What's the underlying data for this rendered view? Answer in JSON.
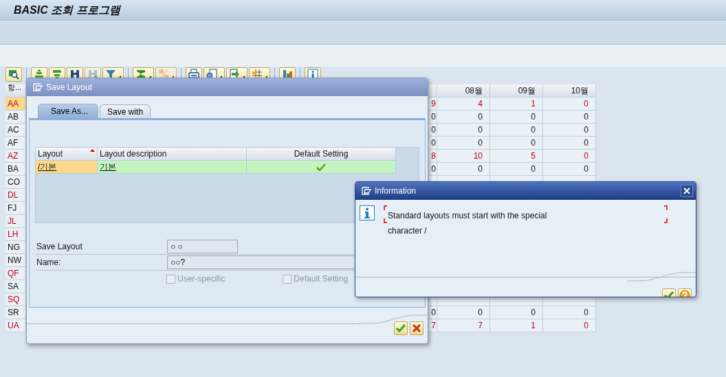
{
  "window": {
    "title": "BASIC 조회 프로그램"
  },
  "toolbar": [
    [
      {
        "kind": "details",
        "disabled": false,
        "menu": false
      }
    ],
    [
      {
        "kind": "sort-up",
        "disabled": false,
        "menu": false
      },
      {
        "kind": "sort-down",
        "disabled": false,
        "menu": false
      },
      {
        "kind": "find",
        "disabled": false,
        "menu": false
      },
      {
        "kind": "find-next",
        "disabled": true,
        "menu": false
      },
      {
        "kind": "filter",
        "disabled": false,
        "menu": true
      }
    ],
    [
      {
        "kind": "sum",
        "disabled": false,
        "menu": true
      },
      {
        "kind": "subtotal",
        "disabled": true,
        "menu": true
      }
    ],
    [
      {
        "kind": "print",
        "disabled": false,
        "menu": false
      },
      {
        "kind": "view",
        "disabled": false,
        "menu": true
      },
      {
        "kind": "export",
        "disabled": false,
        "menu": true
      },
      {
        "kind": "layout",
        "disabled": false,
        "menu": true
      }
    ],
    [
      {
        "kind": "chart",
        "disabled": false,
        "menu": false
      }
    ],
    [
      {
        "kind": "info",
        "disabled": false,
        "menu": false
      }
    ]
  ],
  "grid": {
    "code_header": "항...",
    "month_headers": [
      "08월",
      "09월",
      "10월"
    ],
    "rows": [
      {
        "code": "AA",
        "alert": true,
        "selected": true,
        "values": [
          "9",
          "4",
          "1",
          "0"
        ]
      },
      {
        "code": "AB",
        "alert": false,
        "selected": false,
        "values": [
          "0",
          "0",
          "0",
          "0"
        ]
      },
      {
        "code": "AC",
        "alert": false,
        "selected": false,
        "values": [
          "0",
          "0",
          "0",
          "0"
        ]
      },
      {
        "code": "AF",
        "alert": false,
        "selected": false,
        "values": [
          "0",
          "0",
          "0",
          "0"
        ]
      },
      {
        "code": "AZ",
        "alert": true,
        "selected": false,
        "values": [
          "8",
          "10",
          "5",
          "0"
        ]
      },
      {
        "code": "BA",
        "alert": false,
        "selected": false,
        "values": [
          "0",
          "0",
          "0",
          "0"
        ]
      },
      {
        "code": "CO",
        "alert": false,
        "selected": false
      },
      {
        "code": "DL",
        "alert": true,
        "selected": false
      },
      {
        "code": "FJ",
        "alert": false,
        "selected": false
      },
      {
        "code": "JL",
        "alert": true,
        "selected": false
      },
      {
        "code": "LH",
        "alert": true,
        "selected": false
      },
      {
        "code": "NG",
        "alert": false,
        "selected": false
      },
      {
        "code": "NW",
        "alert": false,
        "selected": false
      },
      {
        "code": "QF",
        "alert": true,
        "selected": false
      },
      {
        "code": "SA",
        "alert": false,
        "selected": false
      },
      {
        "code": "SQ",
        "alert": true,
        "selected": false
      },
      {
        "code": "SR",
        "alert": false,
        "selected": false,
        "values": [
          "0",
          "0",
          "0",
          "0"
        ]
      },
      {
        "code": "UA",
        "alert": true,
        "selected": false,
        "values": [
          "7",
          "7",
          "1",
          "0"
        ]
      }
    ]
  },
  "save_layout_dialog": {
    "title": "Save Layout",
    "tabs": [
      {
        "label": "Save As...",
        "selected": true
      },
      {
        "label": "Save with",
        "selected": false
      }
    ],
    "layouts": {
      "columns": [
        {
          "label": "Layout",
          "sorted": true
        },
        {
          "label": "Layout description",
          "sorted": false
        },
        {
          "label": "Default Setting",
          "sorted": false
        }
      ],
      "rows": [
        {
          "layout": "/기본",
          "description": "기본",
          "default": true
        }
      ]
    },
    "fields": [
      {
        "label": "Save Layout",
        "value": "○ ○"
      },
      {
        "label": "Name:",
        "value": "○○?"
      }
    ],
    "checkboxes": [
      {
        "label": "User-specific",
        "checked": false,
        "disabled": true
      },
      {
        "label": "Default Setting",
        "checked": false,
        "disabled": true
      }
    ],
    "buttons": [
      {
        "kind": "ok"
      },
      {
        "kind": "cancel"
      }
    ]
  },
  "information_dialog": {
    "title": "Information",
    "message": "Standard layouts must start with the special character /",
    "buttons": [
      {
        "kind": "ok"
      },
      {
        "kind": "help"
      }
    ]
  }
}
